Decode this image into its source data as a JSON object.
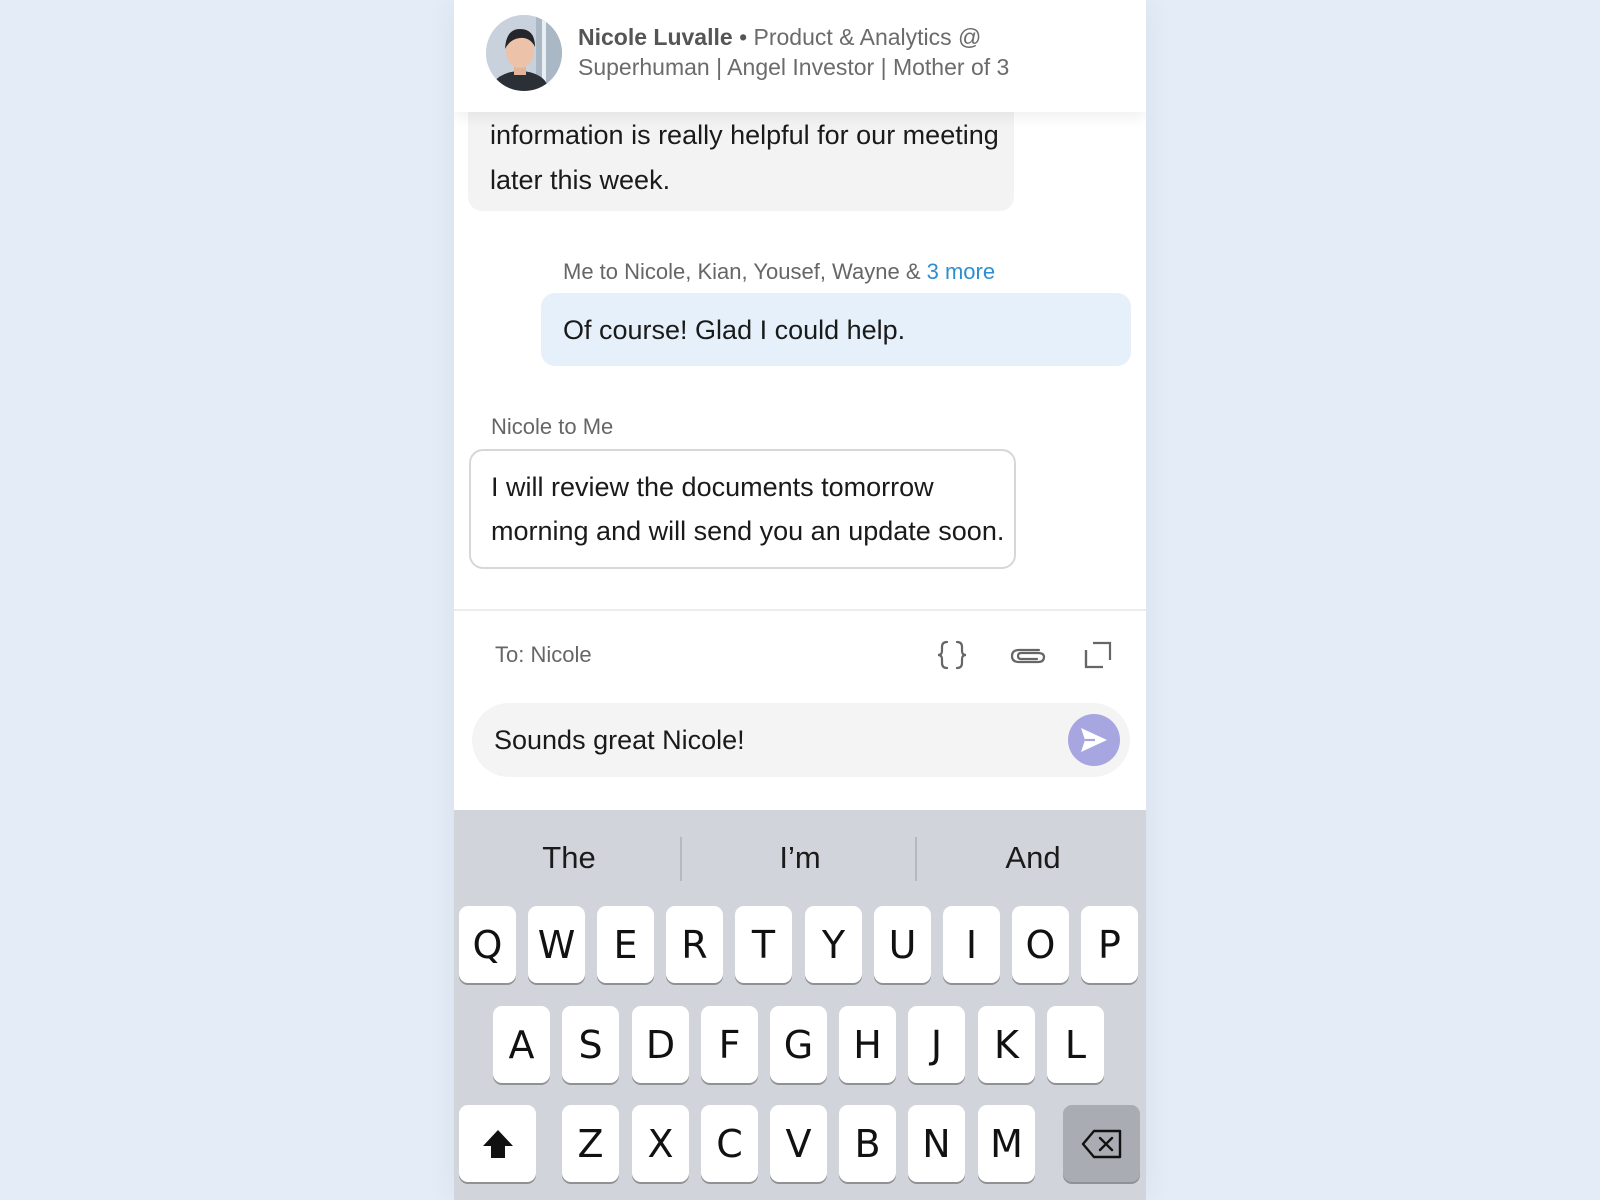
{
  "header": {
    "name": "Nicole Luvalle",
    "separator": "•",
    "subtitle": "Product & Analytics @ Superhuman | Angel Investor | Mother of 3"
  },
  "thread": {
    "prev_message": "information is really helpful for our meeting later this week.",
    "me_meta": "Me to Nicole, Kian, Yousef, Wayne &",
    "me_meta_more": "3 more",
    "me_message": "Of course! Glad I could help.",
    "nicole_meta": "Nicole to Me",
    "nicole_message": "I will review the documents tomorrow morning and will send you an update soon."
  },
  "composer": {
    "to_label": "To: Nicole",
    "input_value": "Sounds great Nicole!",
    "tools": [
      "braces-icon",
      "paperclip-icon",
      "expand-icon"
    ],
    "send_color": "#a8a6e0"
  },
  "keyboard": {
    "suggestions": [
      "The",
      "I’m",
      "And"
    ],
    "row1": [
      "Q",
      "W",
      "E",
      "R",
      "T",
      "Y",
      "U",
      "I",
      "O",
      "P"
    ],
    "row2": [
      "A",
      "S",
      "D",
      "F",
      "G",
      "H",
      "J",
      "K",
      "L"
    ],
    "row3": [
      "Z",
      "X",
      "C",
      "V",
      "B",
      "N",
      "M"
    ],
    "special_keys": [
      "shift-icon",
      "backspace-icon"
    ]
  }
}
